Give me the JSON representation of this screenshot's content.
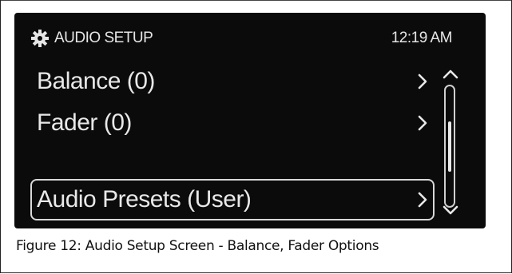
{
  "screen": {
    "header": {
      "icon": "gear-icon",
      "title": "AUDIO SETUP",
      "clock": "12:19 AM"
    },
    "menu_items": [
      {
        "label": "Balance (0)",
        "selected": false
      },
      {
        "label": "Fader (0)",
        "selected": false
      },
      {
        "label": "Audio Presets (User)",
        "selected": true
      }
    ],
    "scrollbar": {
      "position": 0.5,
      "visible_fraction": 0.5
    },
    "colors": {
      "background": "#0b0b0b",
      "text": "#e8e8e8",
      "selection_border": "#d8d8d8"
    }
  },
  "caption": "Figure 12: Audio Setup Screen - Balance, Fader Options"
}
